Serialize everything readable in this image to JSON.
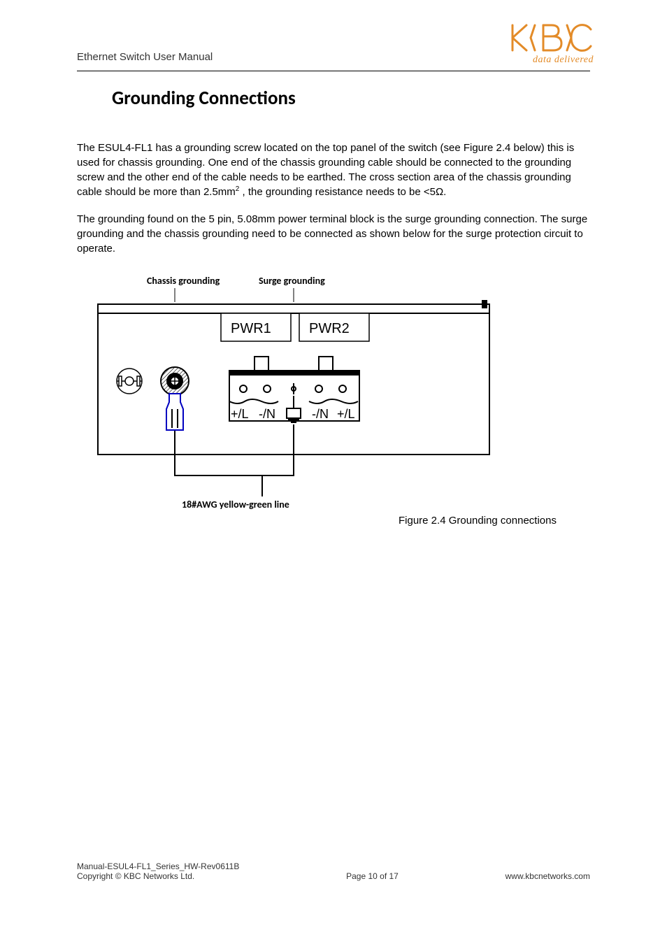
{
  "header": {
    "title": "Ethernet Switch User Manual",
    "logo": {
      "name": "kbc-logo",
      "tagline": "data delivered"
    }
  },
  "section": {
    "title": "Grounding Connections"
  },
  "paragraphs": {
    "p1_a": "The ESUL4-FL1 has a grounding screw located on the top panel of the switch (see Figure 2.4 below) this is used for chassis grounding. One end of the chassis grounding cable should be connected to the grounding screw and the other end of the cable needs to be earthed. The cross section area of the chassis grounding cable should be more than 2.5mm",
    "p1_sup": "2",
    "p1_b": " , the grounding resistance needs to be <5Ω.",
    "p2": "The grounding found on the 5 pin, 5.08mm power terminal block is the surge grounding connection. The surge grounding and the chassis grounding need to be connected as shown below for the surge protection circuit to operate."
  },
  "figure": {
    "labels": {
      "chassis": "Chassis grounding",
      "surge": "Surge grounding",
      "pwr1": "PWR1",
      "pwr2": "PWR2",
      "pin_pl": "+/L",
      "pin_mn": "-/N",
      "wire": "18#AWG yellow-green line"
    },
    "caption": "Figure 2.4 Grounding connections"
  },
  "footer": {
    "left_line1": "Manual-ESUL4-FL1_Series_HW-Rev0611B",
    "left_line2": "Copyright © KBC Networks Ltd.",
    "center": "Page 10 of 17",
    "right": "www.kbcnetworks.com"
  }
}
